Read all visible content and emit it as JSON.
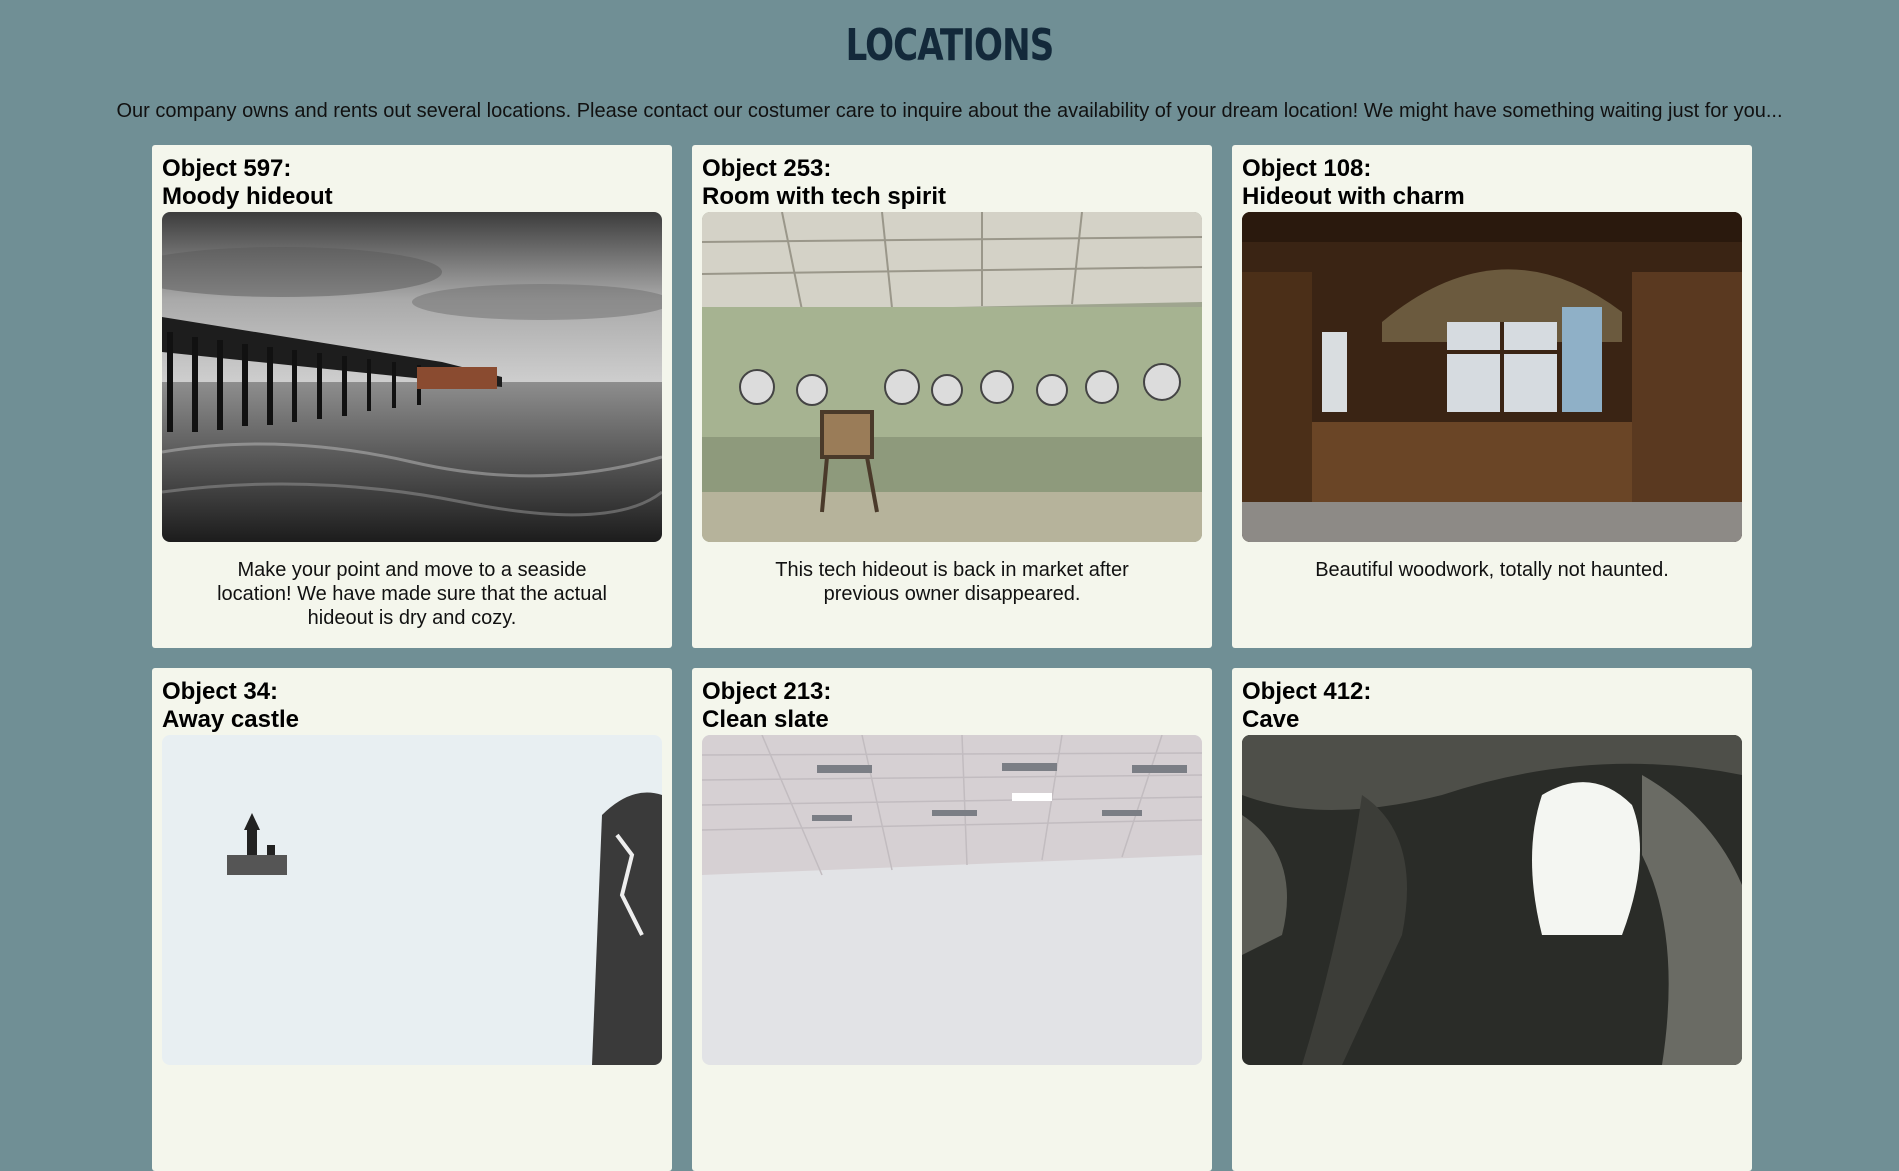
{
  "header": {
    "title": "LOCATIONS"
  },
  "intro": "Our company owns and rents out several locations. Please contact our costumer care to inquire about the availability of your dream location! We might have something waiting just for you...",
  "cards": [
    {
      "object": "Object 597:",
      "name": "Moody hideout",
      "description": "Make your point and move to a seaside location! We have made sure that the actual hideout is dry and cozy.",
      "image": "seaside-pier-photo"
    },
    {
      "object": "Object 253:",
      "name": "Room with tech spirit",
      "description": "This tech hideout is back in market after previous owner disappeared.",
      "image": "control-room-photo"
    },
    {
      "object": "Object 108:",
      "name": "Hideout with charm",
      "description": "Beautiful woodwork, totally not haunted.",
      "image": "wooden-room-photo"
    },
    {
      "object": "Object 34:",
      "name": "Away castle",
      "description": "",
      "image": "snowy-castle-photo"
    },
    {
      "object": "Object 213:",
      "name": "Clean slate",
      "description": "",
      "image": "empty-office-photo"
    },
    {
      "object": "Object 412:",
      "name": "Cave",
      "description": "",
      "image": "cave-photo"
    }
  ],
  "colors": {
    "background": "#708f95",
    "card": "#f4f6ec",
    "title": "#13293a"
  }
}
